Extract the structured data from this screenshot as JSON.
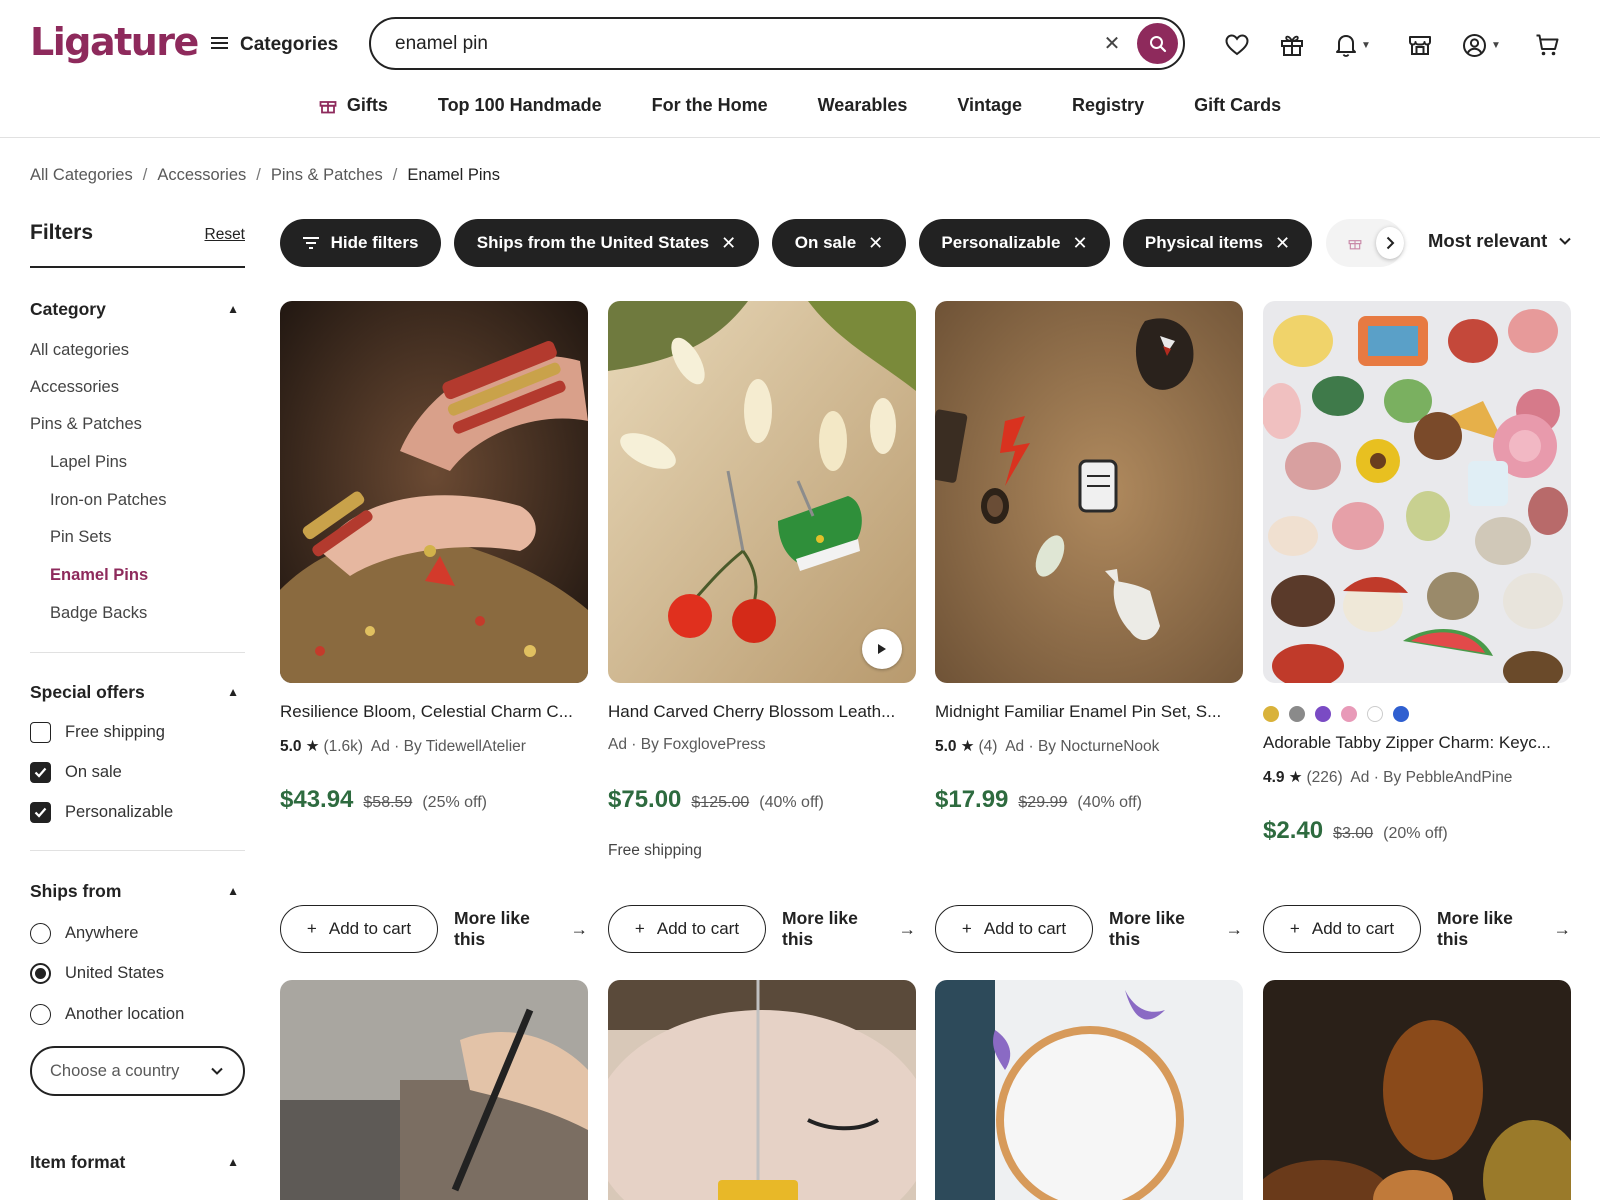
{
  "header": {
    "logo": "Ligature",
    "categories_label": "Categories",
    "search_value": "enamel pin",
    "icons": [
      "heart-icon",
      "gift-icon",
      "bell-icon",
      "shop-icon",
      "account-icon",
      "cart-icon"
    ]
  },
  "topnav": [
    "Gifts",
    "Top 100 Handmade",
    "For the Home",
    "Wearables",
    "Vintage",
    "Registry",
    "Gift Cards"
  ],
  "breadcrumb": [
    "All Categories",
    "Accessories",
    "Pins & Patches",
    "Enamel Pins"
  ],
  "filters": {
    "title": "Filters",
    "reset": "Reset",
    "category": {
      "title": "Category",
      "items": [
        "All categories",
        "Accessories",
        "Pins & Patches"
      ],
      "subitems": [
        "Lapel Pins",
        "Iron-on Patches",
        "Pin Sets",
        "Enamel Pins",
        "Badge Backs"
      ],
      "active": "Enamel Pins"
    },
    "special_offers": {
      "title": "Special offers",
      "options": [
        {
          "label": "Free shipping",
          "checked": false
        },
        {
          "label": "On sale",
          "checked": true
        },
        {
          "label": "Personalizable",
          "checked": true
        }
      ]
    },
    "ships_from": {
      "title": "Ships from",
      "options": [
        {
          "label": "Anywhere",
          "selected": false
        },
        {
          "label": "United States",
          "selected": true
        },
        {
          "label": "Another location",
          "selected": false
        }
      ],
      "country_placeholder": "Choose a country"
    },
    "item_format": {
      "title": "Item format"
    }
  },
  "chips": {
    "hide_filters": "Hide filters",
    "active": [
      "Ships from the United States",
      "On sale",
      "Personalizable",
      "Physical items"
    ]
  },
  "sort": {
    "label": "Most relevant"
  },
  "products": [
    {
      "title": "Resilience Bloom, Celestial Charm C...",
      "rating": "5.0",
      "reviews": "(1.6k)",
      "ad": "Ad",
      "seller": "By TidewellAtelier",
      "price": "$43.94",
      "was": "$58.59",
      "off": "(25% off)"
    },
    {
      "title": "Hand Carved Cherry Blossom Leath...",
      "ad": "Ad",
      "seller": "By FoxglovePress",
      "price": "$75.00",
      "was": "$125.00",
      "off": "(40% off)",
      "shipping": "Free shipping"
    },
    {
      "title": "Midnight Familiar Enamel Pin Set, S...",
      "rating": "5.0",
      "reviews": "(4)",
      "ad": "Ad",
      "seller": "By NocturneNook",
      "price": "$17.99",
      "was": "$29.99",
      "off": "(40% off)"
    },
    {
      "title": "Adorable Tabby Zipper Charm: Keyc...",
      "rating": "4.9",
      "reviews": "(226)",
      "ad": "Ad",
      "seller": "By PebbleAndPine",
      "price": "$2.40",
      "was": "$3.00",
      "off": "(20% off)",
      "swatches": [
        "#d9b23a",
        "#8a8a8a",
        "#7a4bc4",
        "#e89ab8",
        "#ffffff",
        "#2f5fd0"
      ]
    }
  ],
  "card_actions": {
    "add_to_cart": "Add to cart",
    "more_like_this": "More like this"
  },
  "colors": {
    "brand": "#8e2a5c",
    "price_green": "#2e6b3f",
    "chip_dark": "#222222"
  }
}
